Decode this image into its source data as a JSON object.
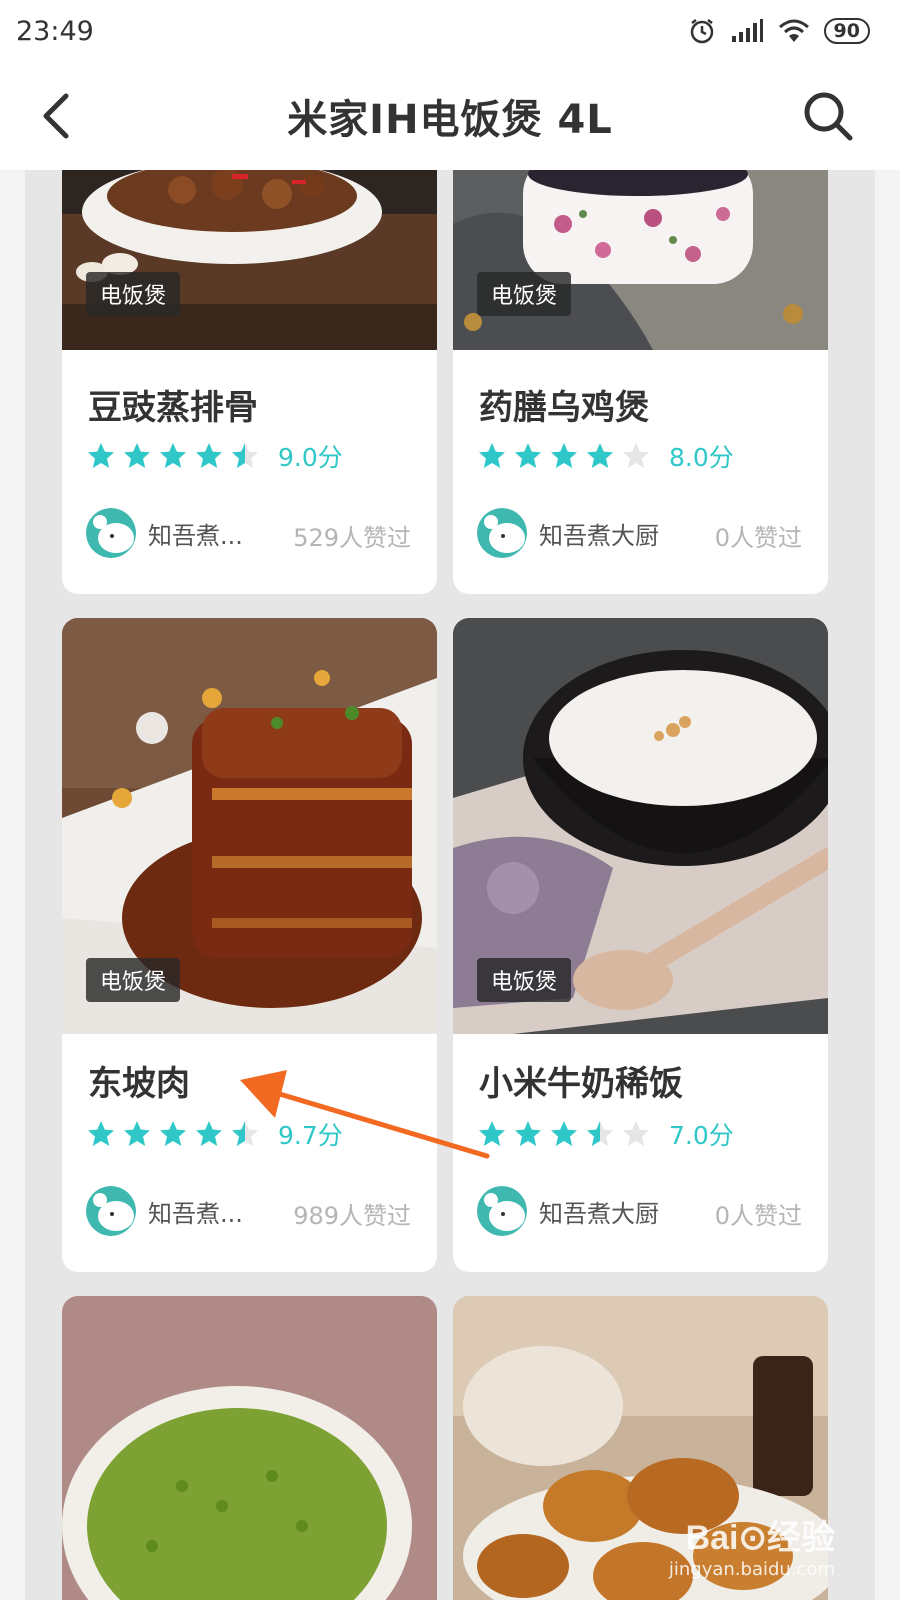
{
  "status_bar": {
    "time": "23:49",
    "battery": "90"
  },
  "header": {
    "title": "米家IH电饭煲 4L"
  },
  "colors": {
    "accent": "#2fc7c7",
    "star_empty": "#e6e6e6",
    "arrow": "#f26a21"
  },
  "recipes": [
    {
      "title": "豆豉蒸排骨",
      "tag": "电饭煲",
      "rating": 4.5,
      "score": "9.0分",
      "author": "知吾煮...",
      "likes": "529人赞过"
    },
    {
      "title": "药膳乌鸡煲",
      "tag": "电饭煲",
      "rating": 4.0,
      "score": "8.0分",
      "author": "知吾煮大厨",
      "likes": "0人赞过"
    },
    {
      "title": "东坡肉",
      "tag": "电饭煲",
      "rating": 4.5,
      "score": "9.7分",
      "author": "知吾煮...",
      "likes": "989人赞过"
    },
    {
      "title": "小米牛奶稀饭",
      "tag": "电饭煲",
      "rating": 3.5,
      "score": "7.0分",
      "author": "知吾煮大厨",
      "likes": "0人赞过"
    }
  ],
  "watermark": {
    "logo": "Bai⊙经验",
    "url": "jingyan.baidu.com"
  }
}
